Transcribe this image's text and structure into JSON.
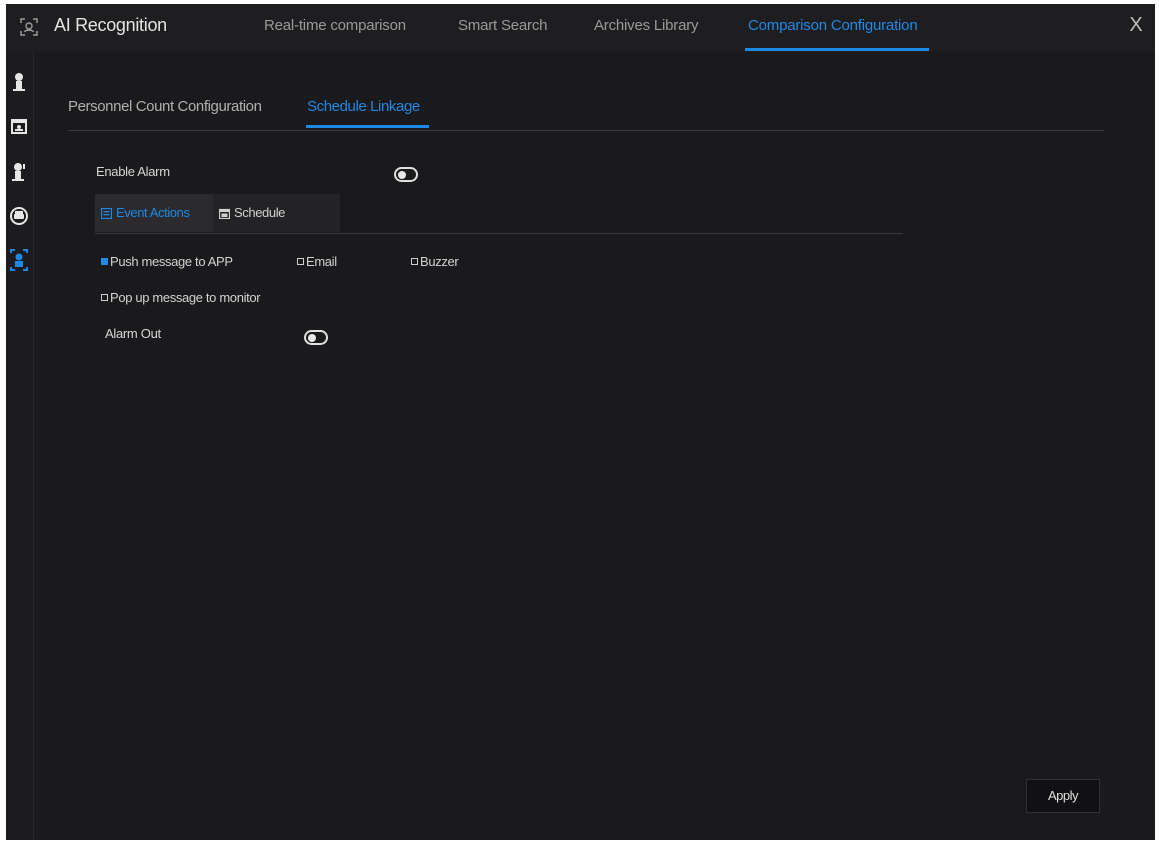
{
  "app": {
    "title": "AI Recognition",
    "icon": "face-scan-icon"
  },
  "top_tabs": [
    {
      "label": "Real-time comparison",
      "active": false
    },
    {
      "label": "Smart Search",
      "active": false
    },
    {
      "label": "Archives Library",
      "active": false
    },
    {
      "label": "Comparison Configuration",
      "active": true
    }
  ],
  "window": {
    "close_label": "X"
  },
  "sidebar": {
    "items": [
      {
        "icon": "person-icon",
        "active": false
      },
      {
        "icon": "id-card-icon",
        "active": false
      },
      {
        "icon": "person-count-icon",
        "active": false
      },
      {
        "icon": "vehicle-icon",
        "active": false
      },
      {
        "icon": "comparison-config-icon",
        "active": true
      }
    ]
  },
  "sub_tabs": [
    {
      "label": "Personnel Count Configuration",
      "active": false
    },
    {
      "label": "Schedule Linkage",
      "active": true
    }
  ],
  "enable_alarm": {
    "label": "Enable Alarm",
    "on": false
  },
  "inner_tabs": [
    {
      "label": "Event Actions",
      "icon": "event-actions-icon",
      "active": true
    },
    {
      "label": "Schedule",
      "icon": "calendar-icon",
      "active": false
    }
  ],
  "actions": {
    "push_app": {
      "label": "Push message to APP",
      "checked": true
    },
    "email": {
      "label": "Email",
      "checked": false
    },
    "buzzer": {
      "label": "Buzzer",
      "checked": false
    },
    "popup": {
      "label": "Pop up message to monitor",
      "checked": false
    }
  },
  "alarm_out": {
    "label": "Alarm Out",
    "on": false
  },
  "apply_label": "Apply",
  "colors": {
    "accent": "#1e88e5",
    "background": "#1b1b1d"
  }
}
